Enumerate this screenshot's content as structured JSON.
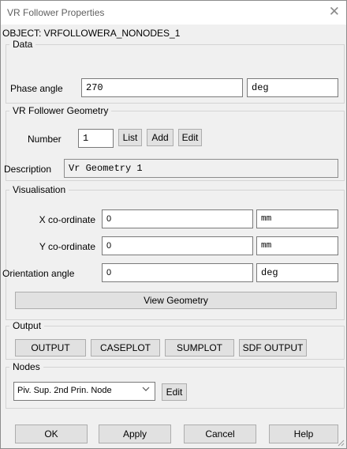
{
  "window": {
    "title": "VR Follower Properties",
    "close_glyph": "✕"
  },
  "object_line": "OBJECT: VRFOLLOWERA_NONODES_1",
  "data_group": {
    "legend": "Data",
    "phase_label": "Phase angle",
    "phase_value": "270",
    "phase_unit": "deg"
  },
  "geometry_group": {
    "legend": "VR Follower Geometry",
    "number_label": "Number",
    "number_value": "1",
    "list_label": "List",
    "add_label": "Add",
    "edit_label": "Edit",
    "description_label": "Description",
    "description_value": "Vr Geometry 1"
  },
  "visualisation_group": {
    "legend": "Visualisation",
    "x_label": "X co-ordinate",
    "x_value": "0",
    "x_unit": "mm",
    "y_label": "Y co-ordinate",
    "y_value": "0",
    "y_unit": "mm",
    "orientation_label": "Orientation angle",
    "orientation_value": "0",
    "orientation_unit": "deg",
    "view_geometry_label": "View Geometry"
  },
  "output_group": {
    "legend": "Output",
    "buttons": [
      "OUTPUT",
      "CASEPLOT",
      "SUMPLOT",
      "SDF OUTPUT"
    ]
  },
  "nodes_group": {
    "legend": "Nodes",
    "selected_node": "Piv. Sup. 2nd Prin. Node",
    "edit_label": "Edit"
  },
  "footer": {
    "ok_label": "OK",
    "apply_label": "Apply",
    "cancel_label": "Cancel",
    "help_label": "Help"
  },
  "icons": {
    "close": "close-icon",
    "dropdown": "chevron-down-icon",
    "resize": "resize-grip-icon"
  }
}
